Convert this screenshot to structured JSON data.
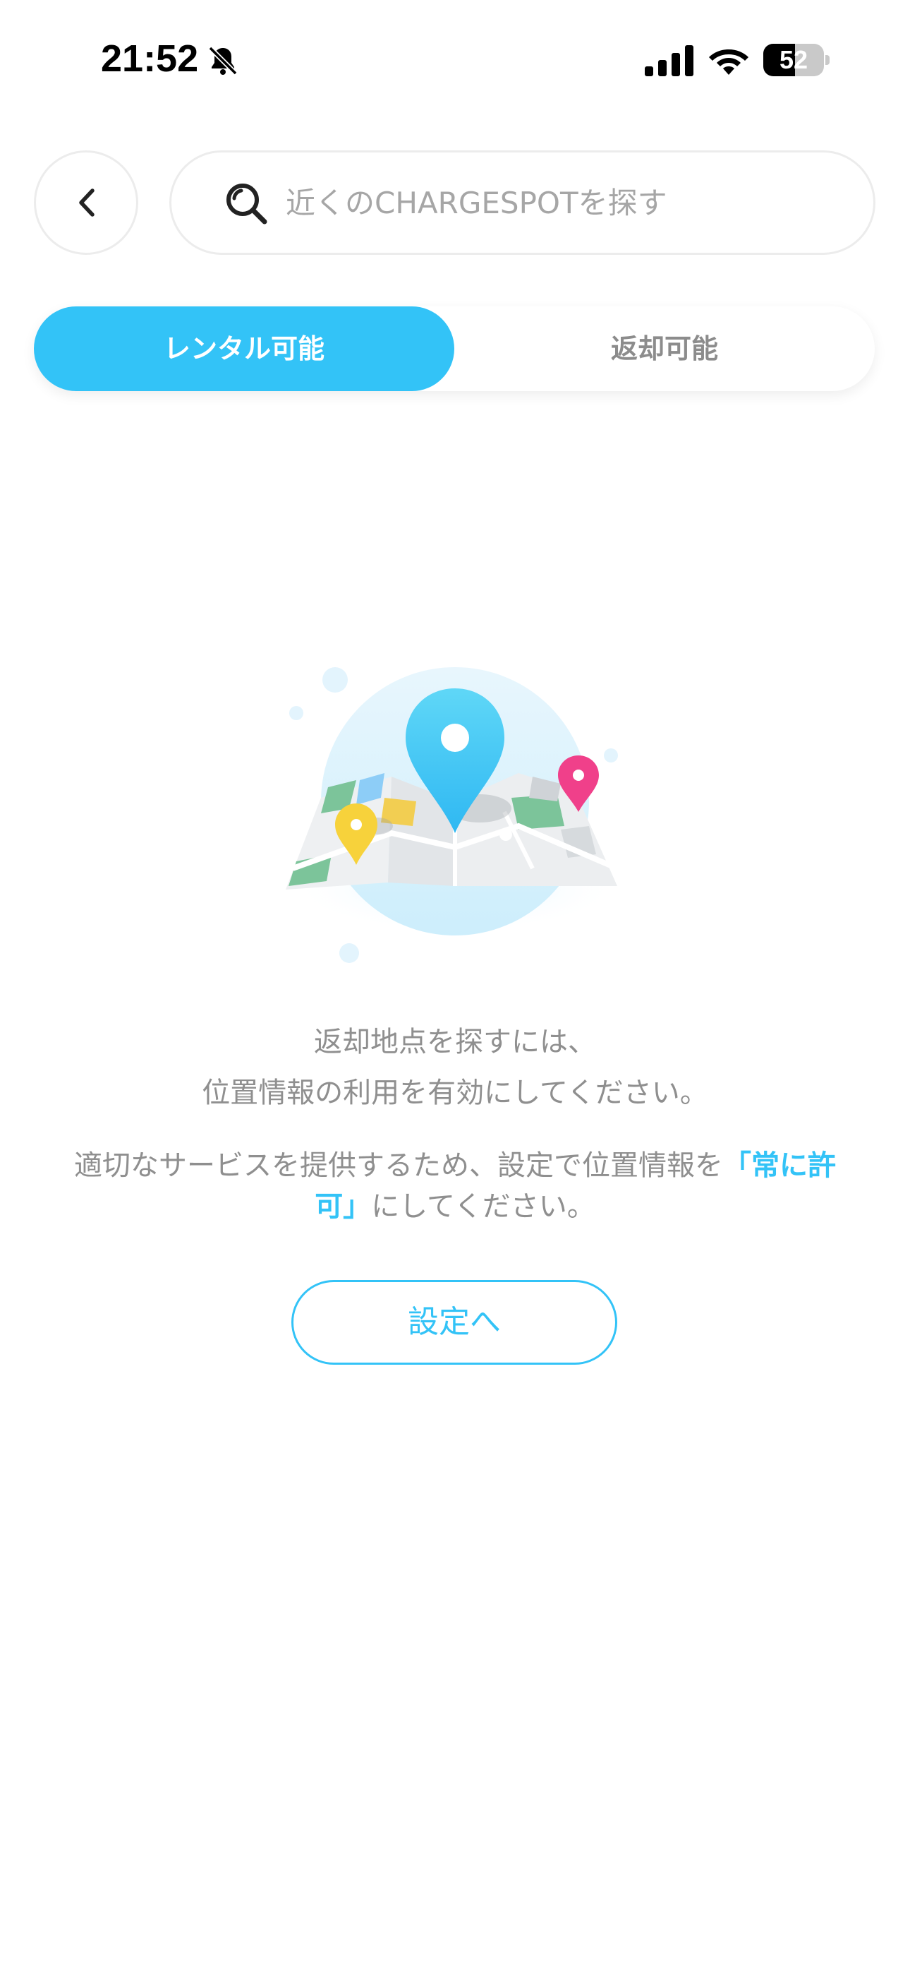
{
  "status_bar": {
    "time": "21:52",
    "battery_level": "52",
    "battery_fraction": 0.52,
    "icons": [
      "bell-slash-icon",
      "cellular-signal-icon",
      "wifi-icon",
      "battery-icon"
    ]
  },
  "header": {
    "back_icon": "chevron-left-icon",
    "search_icon": "search-icon",
    "search_placeholder": "近くのCHARGESPOTを探す"
  },
  "tabs": [
    {
      "label": "レンタル可能",
      "selected": true
    },
    {
      "label": "返却可能",
      "selected": false
    }
  ],
  "illustration": {
    "name": "map-with-location-pins-illustration",
    "colors": {
      "accent": "#33c3f7",
      "pin_blue": "#3cc6f5",
      "pin_pink": "#f0408a",
      "pin_yellow": "#f7d23b",
      "circle": "#dff3fd"
    }
  },
  "message": {
    "line1": "返却地点を探すには、",
    "line2": "位置情報の利用を有効にしてください。",
    "detail_prefix": "適切なサービスを提供するため、設定で位置情報を",
    "detail_highlight": "「常に許可」",
    "detail_suffix": "にしてください。"
  },
  "settings_button": {
    "label": "設定へ"
  },
  "colors": {
    "accent": "#33c3f7",
    "text_muted": "#8f8f8f",
    "border": "#ececec"
  }
}
